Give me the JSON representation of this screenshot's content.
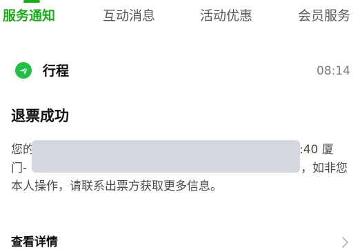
{
  "tabs": [
    {
      "label": "服务通知",
      "active": true
    },
    {
      "label": "互动消息",
      "active": false
    },
    {
      "label": "活动优惠",
      "active": false
    },
    {
      "label": "会员服务",
      "active": false
    }
  ],
  "card": {
    "service_icon": "plane-icon",
    "service_name": "行程",
    "time": "08:14",
    "title": "退票成功",
    "body_lines": [
      {
        "left": "您的",
        "right": ":40 厦"
      },
      {
        "left": "门-",
        "right": "，如非您"
      },
      {
        "text": "本人操作，请联系出票方获取更多信息。"
      }
    ],
    "detail_label": "查看详情",
    "detail_icon": "chevron-right-icon"
  },
  "colors": {
    "accent": "#1aad19",
    "icon_bg": "#22bf46",
    "redaction": "#d3d8de",
    "muted": "#7a7a7a"
  }
}
